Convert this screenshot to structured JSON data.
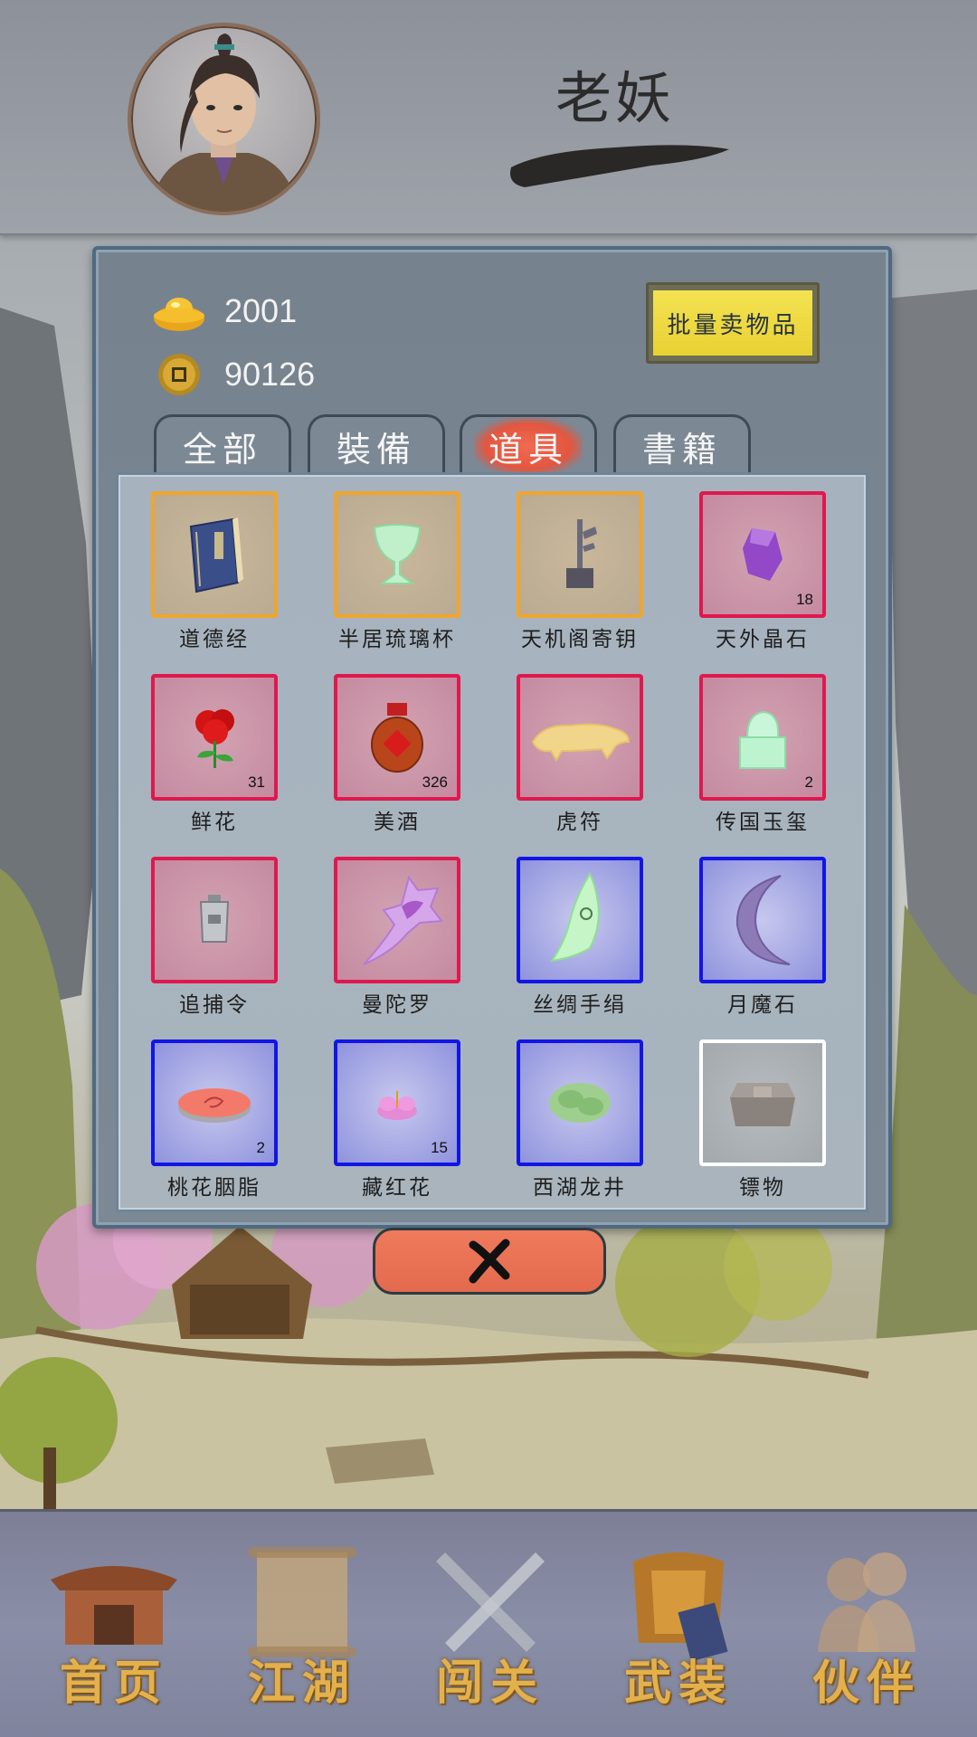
{
  "header": {
    "player_name": "老妖"
  },
  "currency": {
    "gold_ingot": "2001",
    "copper_coin": "90126"
  },
  "buttons": {
    "bulk_sell": "批量卖物品"
  },
  "tabs": [
    {
      "label": "全部",
      "active": false
    },
    {
      "label": "裝備",
      "active": false
    },
    {
      "label": "道具",
      "active": true
    },
    {
      "label": "書籍",
      "active": false
    }
  ],
  "items": [
    {
      "name": "道德经",
      "count": "",
      "quality": "orange",
      "icon": "book-icon"
    },
    {
      "name": "半居琉璃杯",
      "count": "",
      "quality": "orange",
      "icon": "cup-icon"
    },
    {
      "name": "天机阁寄钥",
      "count": "",
      "quality": "orange",
      "icon": "key-icon"
    },
    {
      "name": "天外晶石",
      "count": "18",
      "quality": "red",
      "icon": "crystal-icon"
    },
    {
      "name": "鲜花",
      "count": "31",
      "quality": "red",
      "icon": "rose-icon"
    },
    {
      "name": "美酒",
      "count": "326",
      "quality": "red",
      "icon": "wine-jar-icon"
    },
    {
      "name": "虎符",
      "count": "",
      "quality": "red",
      "icon": "tiger-tally-icon"
    },
    {
      "name": "传国玉玺",
      "count": "2",
      "quality": "red",
      "icon": "jade-seal-icon"
    },
    {
      "name": "追捕令",
      "count": "",
      "quality": "red",
      "icon": "token-icon"
    },
    {
      "name": "曼陀罗",
      "count": "",
      "quality": "red",
      "icon": "datura-flower-icon"
    },
    {
      "name": "丝绸手绢",
      "count": "",
      "quality": "blue",
      "icon": "silk-handkerchief-icon"
    },
    {
      "name": "月魔石",
      "count": "",
      "quality": "blue",
      "icon": "moon-stone-icon"
    },
    {
      "name": "桃花胭脂",
      "count": "2",
      "quality": "blue",
      "icon": "rouge-icon"
    },
    {
      "name": "藏红花",
      "count": "15",
      "quality": "blue",
      "icon": "saffron-icon"
    },
    {
      "name": "西湖龙井",
      "count": "",
      "quality": "blue",
      "icon": "tea-leaves-icon"
    },
    {
      "name": "镖物",
      "count": "",
      "quality": "white",
      "icon": "cargo-box-icon"
    }
  ],
  "nav": [
    {
      "label": "首页",
      "icon": "house-icon"
    },
    {
      "label": "江湖",
      "icon": "scroll-icon"
    },
    {
      "label": "闯关",
      "icon": "crossed-swords-icon"
    },
    {
      "label": "武装",
      "icon": "armor-icon"
    },
    {
      "label": "伙伴",
      "icon": "companions-icon"
    }
  ],
  "colors": {
    "quality_orange": "#f0a52d",
    "quality_red": "#e0184e",
    "quality_blue": "#1215e6",
    "quality_white": "#ffffff",
    "active_tab": "#e4563f",
    "bulk_sell": "#e8d133",
    "nav_label": "#e3b04b"
  }
}
